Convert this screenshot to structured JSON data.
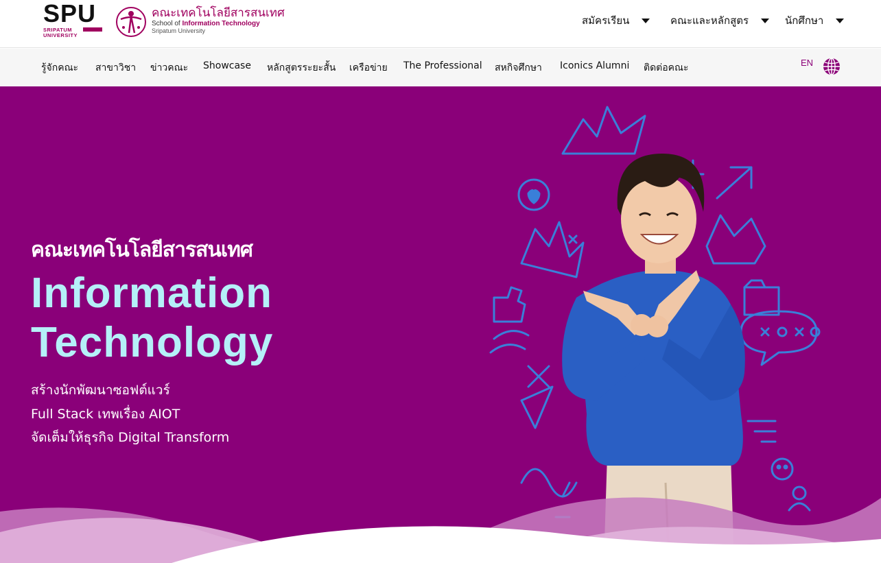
{
  "header": {
    "logo_spu": "SPU",
    "logo_spu_sub1": "SRIPATUM",
    "logo_spu_sub2": "UNIVERSITY",
    "logo_it_th": "คณะเทคโนโลยีสารสนเทศ",
    "logo_it_en_prefix": "School of ",
    "logo_it_en_bold": "Information Technology",
    "logo_it_en2": "Sripatum University",
    "menus": [
      {
        "label": "สมัครเรียน"
      },
      {
        "label": "คณะและหลักสูตร"
      },
      {
        "label": "นักศึกษา"
      }
    ]
  },
  "nav": {
    "items": [
      {
        "label": "รู้จักคณะ"
      },
      {
        "label": "สาขาวิชา"
      },
      {
        "label": "ข่าวคณะ"
      },
      {
        "label": "Showcase"
      },
      {
        "label": "หลักสูตรระยะสั้น"
      },
      {
        "label": "เครือข่าย"
      },
      {
        "label": "The Professional"
      },
      {
        "label": "สหกิจศึกษา"
      },
      {
        "label": "Iconics Alumni"
      },
      {
        "label": "ติดต่อคณะ"
      }
    ],
    "lang": "EN",
    "globe_icon": "globe-icon"
  },
  "hero": {
    "title_th": "คณะเทคโนโลยีสารสนเทศ",
    "title_en_line1": "Information",
    "title_en_line2": "Technology",
    "tagline": [
      "สร้างนักพัฒนาซอฟต์แวร์",
      "Full Stack เทพเรื่อง AIOT",
      "จัดเต็มให้ธุรกิจ Digital Transform"
    ],
    "doodle_text": "xoxo"
  },
  "colors": {
    "brand_purple": "#8a0079",
    "accent_cyan": "#b5f0f8",
    "doodle_blue": "#3a7fd9",
    "spu_magenta": "#a0005f"
  }
}
